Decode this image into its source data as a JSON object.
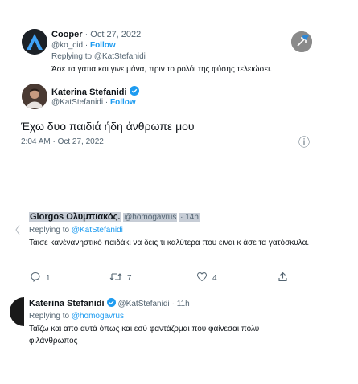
{
  "cooper": {
    "name": "Cooper",
    "date": "· Oct 27, 2022",
    "handle": "@ko_cid",
    "follow": "Follow",
    "replying_prefix": "Replying to ",
    "replying_to": "@KatStefanidi",
    "text": "Άσε τα γατια και γινε μάνα, πριν το ρολόι της φύσης τελειώσει."
  },
  "katerina_tweet": {
    "name": "Katerina Stefanidi",
    "handle": "@KatStefanidi",
    "follow": "Follow",
    "text": "Έχω δυο παιδιά ήδη άνθρωπε μου",
    "timestamp": "2:04 AM · Oct 27, 2022",
    "info_glyph": "ⓘ"
  },
  "reply1": {
    "name": "Giorgos Ολυμπιακός.",
    "handle": "@homogavrus",
    "time": "· 14h",
    "replying_prefix": "Replying to ",
    "replying_to": "@KatStefanidi",
    "text": "Τάισε κανένανηστικό παιδάκι να δεις τι καλύτερα που ειναι κ άσε τα γατόσκυλα.",
    "reply_count": "1",
    "retweet_count": "7",
    "like_count": "4"
  },
  "reply2": {
    "name": "Katerina Stefanidi",
    "handle": "@KatStefanidi",
    "time": "· 11h",
    "replying_prefix": "Replying to ",
    "replying_to": "@homogavrus",
    "text": "Ταΐζω και από αυτά όπως και εσύ φαντάζομαι που φαίνεσαι πολύ φιλάνθρωπος"
  },
  "colors": {
    "link_blue": "#1d9bf0",
    "verified_blue": "#1d9bf0",
    "secondary_text": "#536471",
    "handle_highlight": "#c7cdd6"
  },
  "icons": [
    "twitter-bird-icon",
    "verified-badge-icon",
    "info-icon",
    "reply-icon",
    "retweet-icon",
    "like-icon",
    "share-icon"
  ]
}
